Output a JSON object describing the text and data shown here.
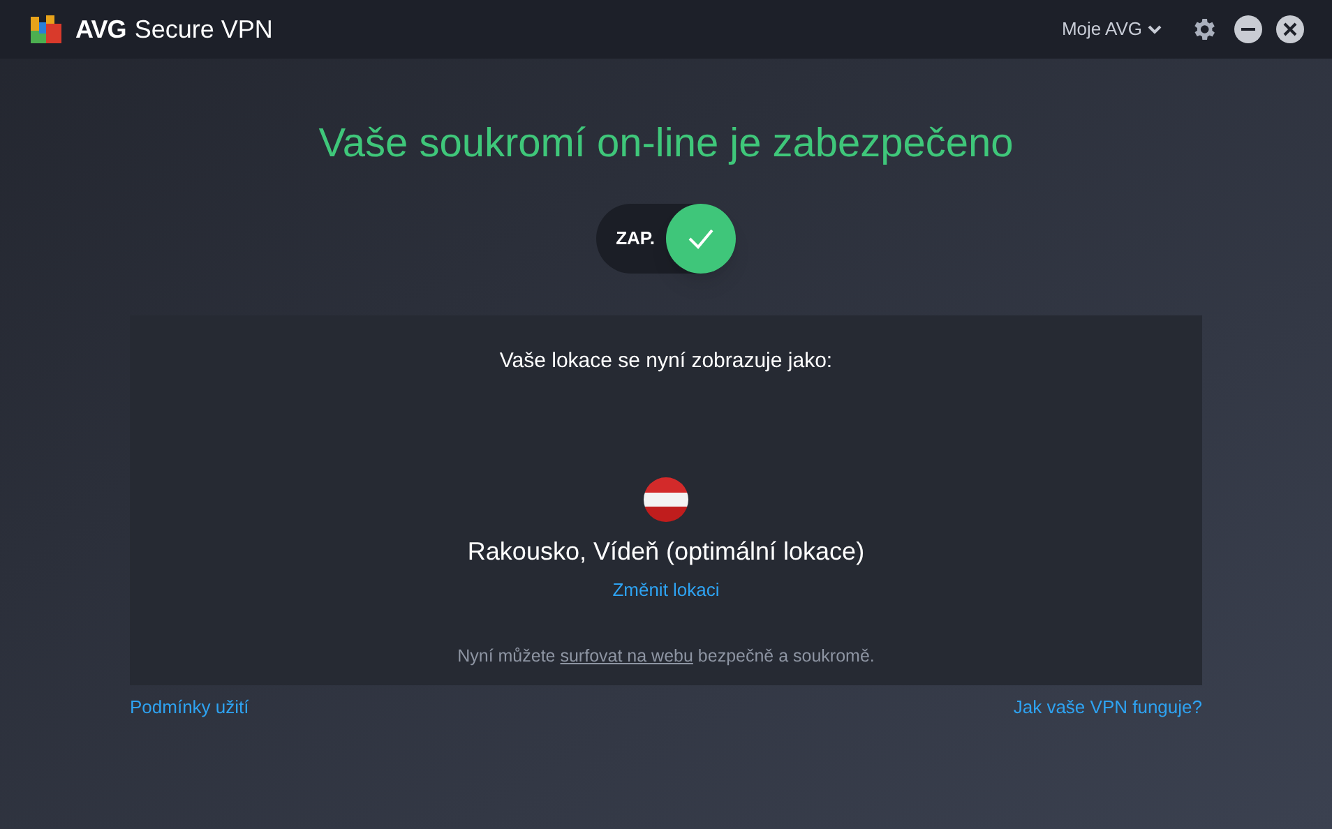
{
  "app": {
    "brand": "AVG",
    "product": "Secure VPN"
  },
  "header": {
    "account_menu": "Moje AVG"
  },
  "status": {
    "title": "Vaše soukromí on-line je zabezpečeno",
    "toggle": {
      "label": "ZAP.",
      "on": true
    }
  },
  "location": {
    "heading": "Vaše lokace se nyní zobrazuje jako:",
    "name": "Rakousko, Vídeň (optimální lokace)",
    "change_link": "Změnit lokaci",
    "note_before": "Nyní můžete ",
    "note_link": "surfovat na webu",
    "note_after": " bezpečně a soukromě."
  },
  "footer": {
    "left_link": "Podmínky užití",
    "right_link": "Jak vaše VPN funguje?"
  }
}
